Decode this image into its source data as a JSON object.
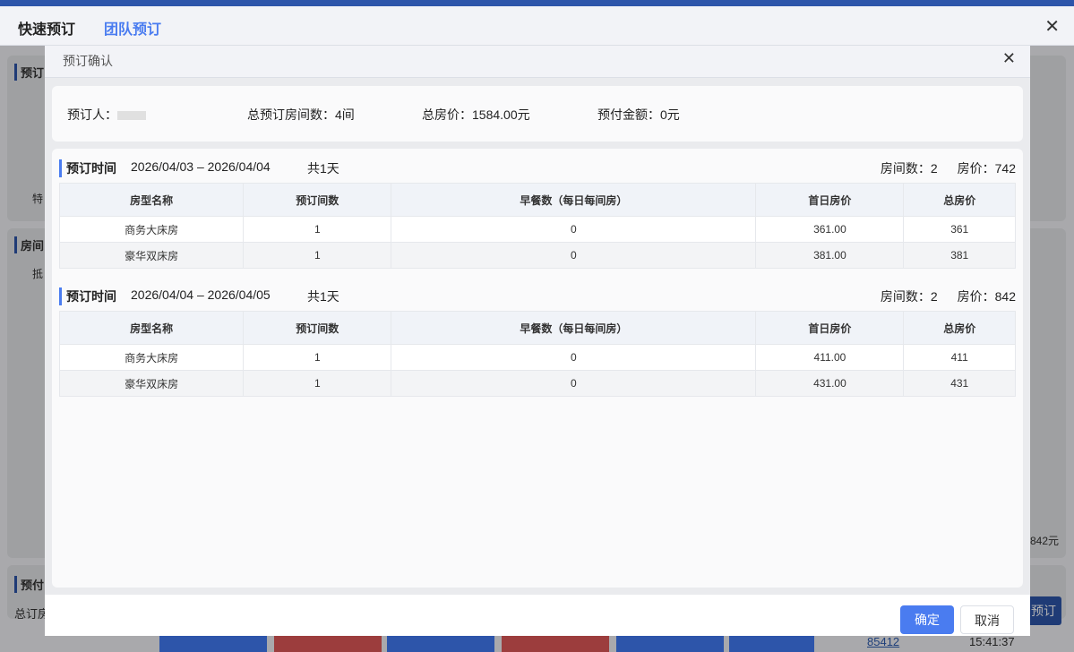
{
  "drawer": {
    "tabs": [
      {
        "label": "快速预订"
      },
      {
        "label": "团队预订"
      }
    ],
    "active_tab": 1
  },
  "background": {
    "labels": [
      "预订",
      "房间",
      "预付"
    ],
    "field_labels": [
      "特",
      "抵"
    ],
    "total_label": "总订房",
    "amount": "842元",
    "book_button": "预订",
    "room_no": "85412",
    "time": "15:41:37"
  },
  "modal": {
    "title": "预订确认",
    "summary": {
      "booker_label": "预订人：",
      "total_rooms": "总预订房间数：4间",
      "total_price": "总房价：1584.00元",
      "prepay": "预付金额：0元"
    },
    "columns": [
      "房型名称",
      "预订间数",
      "早餐数（每日每间房）",
      "首日房价",
      "总房价"
    ],
    "sections": [
      {
        "label": "预订时间",
        "range": "2026/04/03 – 2026/04/04",
        "days": "共1天",
        "rooms": "房间数：2",
        "price": "房价：742",
        "rows": [
          [
            "商务大床房",
            "1",
            "0",
            "361.00",
            "361"
          ],
          [
            "豪华双床房",
            "1",
            "0",
            "381.00",
            "381"
          ]
        ]
      },
      {
        "label": "预订时间",
        "range": "2026/04/04 – 2026/04/05",
        "days": "共1天",
        "rooms": "房间数：2",
        "price": "房价：842",
        "rows": [
          [
            "商务大床房",
            "1",
            "0",
            "411.00",
            "411"
          ],
          [
            "豪华双床房",
            "1",
            "0",
            "431.00",
            "431"
          ]
        ]
      }
    ],
    "confirm": "确定",
    "cancel": "取消"
  },
  "colors": {
    "accent": "#4a7cf0",
    "nav": "#2d55aa"
  }
}
